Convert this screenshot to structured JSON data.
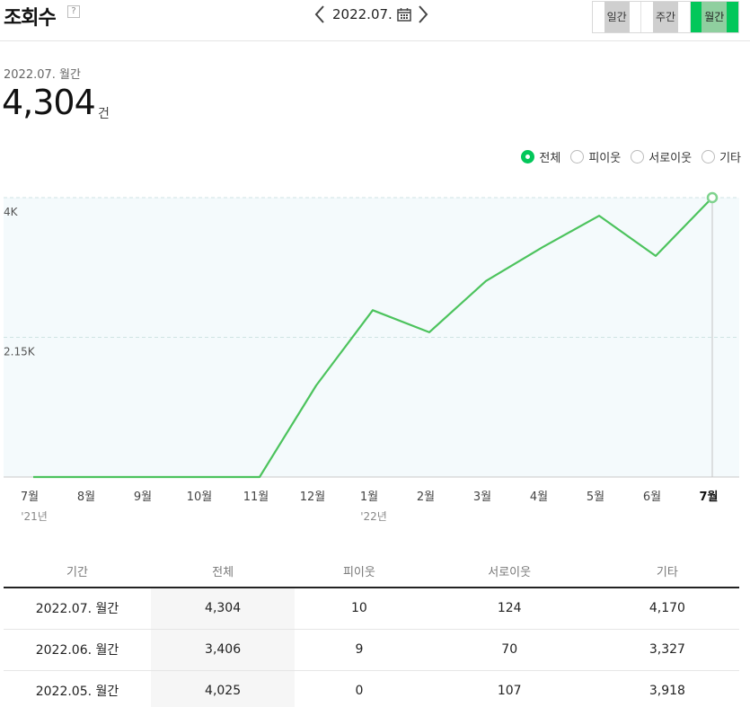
{
  "header": {
    "title": "조회수",
    "help_glyph": "?",
    "date": "2022.07.",
    "period_tabs": [
      "일간",
      "주간",
      "월간"
    ],
    "active_tab": "월간"
  },
  "summary": {
    "period_label": "2022.07. 월간",
    "value": "4,304",
    "unit": "건"
  },
  "filters": {
    "options": [
      "전체",
      "피이웃",
      "서로이웃",
      "기타"
    ],
    "selected": "전체"
  },
  "colors": {
    "accent": "#03c75a",
    "line": "#4cc35d",
    "chart_bg": "#f4fafc"
  },
  "chart_data": {
    "type": "line",
    "categories": [
      "7월",
      "8월",
      "9월",
      "10월",
      "11월",
      "12월",
      "1월",
      "2월",
      "3월",
      "4월",
      "5월",
      "6월",
      "7월"
    ],
    "year_labels": [
      {
        "index": 0,
        "label": "'21년"
      },
      {
        "index": 6,
        "label": "'22년"
      }
    ],
    "series": [
      {
        "values": [
          0,
          0,
          0,
          0,
          0,
          1410,
          2570,
          2230,
          3020,
          3540,
          4025,
          3406,
          4304
        ]
      }
    ],
    "ytick_labels": [
      "4K",
      "2.15K"
    ],
    "ytick_values": [
      4304,
      2152
    ],
    "ylim": [
      0,
      4304
    ],
    "highlight_index": 12,
    "grid": true
  },
  "table": {
    "headers": [
      "기간",
      "전체",
      "피이웃",
      "서로이웃",
      "기타"
    ],
    "rows": [
      [
        "2022.07. 월간",
        "4,304",
        "10",
        "124",
        "4,170"
      ],
      [
        "2022.06. 월간",
        "3,406",
        "9",
        "70",
        "3,327"
      ],
      [
        "2022.05. 월간",
        "4,025",
        "0",
        "107",
        "3,918"
      ]
    ]
  }
}
